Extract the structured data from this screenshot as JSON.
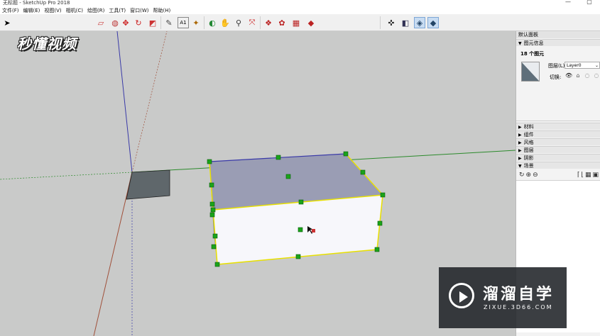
{
  "window": {
    "title": "无标题 - SketchUp Pro 2018",
    "minimize": "—",
    "maximize": "▢"
  },
  "menu": [
    "文件(F)",
    "编辑(E)",
    "视图(V)",
    "相机(C)",
    "绘图(R)",
    "工具(T)",
    "窗口(W)",
    "帮助(H)"
  ],
  "toolbar_icons": [
    "select-icon",
    "eraser-icon",
    "paint-bucket-icon",
    "move-icon",
    "rotate-icon",
    "scale-icon",
    "tape-measure-icon",
    "text-icon",
    "axes-icon",
    "orbit-icon",
    "pan-icon",
    "zoom-icon",
    "zoom-extents-icon",
    "warehouse-icon",
    "components-icon",
    "extension-icon",
    "sandbox-icon",
    "section-plane-icon",
    "views-iso-icon",
    "xray-icon",
    "shaded-icon"
  ],
  "logo_text": "秒懂视频",
  "panel": {
    "title": "默认面板",
    "entity_info": {
      "header": "图元信息",
      "count": "18 个图元",
      "layer_label": "图层(L):",
      "layer_value": "Layer0",
      "toggle_label": "切换:"
    },
    "collapsed_sections": [
      "材料",
      "组件",
      "风格",
      "图层",
      "阴影"
    ],
    "scenes_header": "场景"
  },
  "watermark": {
    "name": "溜溜自学",
    "url": "ZIXUE.3D66.COM"
  },
  "colors": {
    "viewport_bg": "#c9cac9",
    "axis_green": "#2b8a2b",
    "axis_blue": "#3a3aa8",
    "axis_red": "#a0503a",
    "selection_yellow": "#e8e000",
    "grip_green": "#1aa31a",
    "top_face": "#9a9db4",
    "side_face": "#f7f7fb"
  }
}
